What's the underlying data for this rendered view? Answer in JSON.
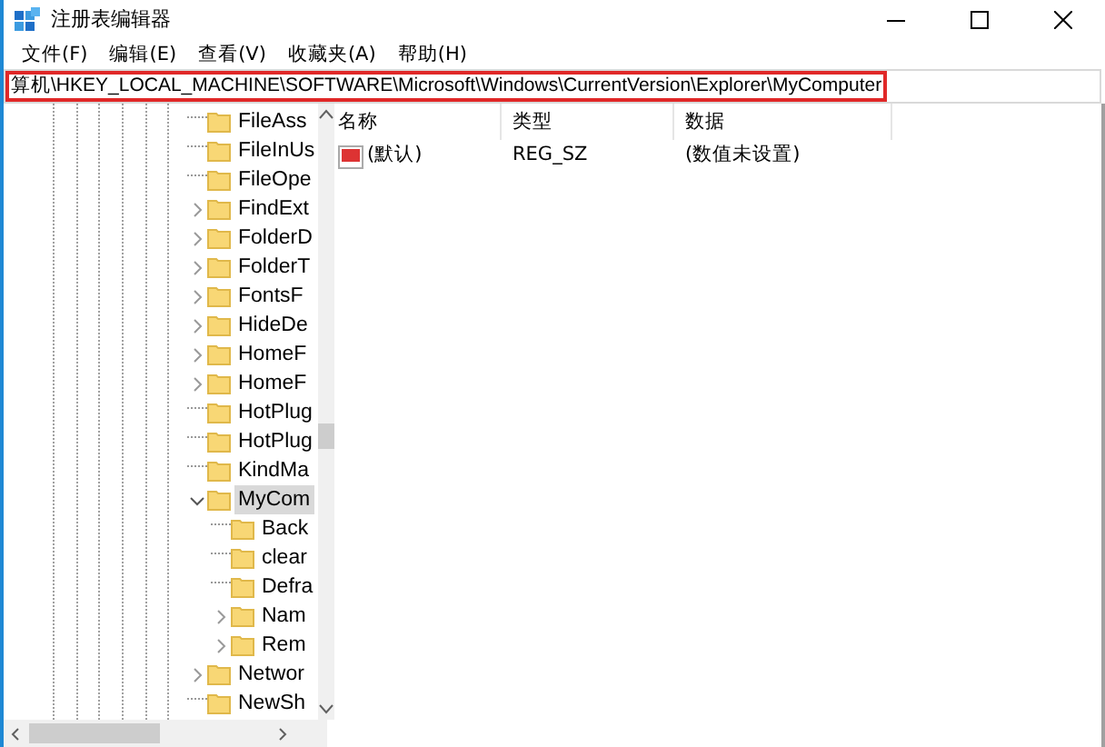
{
  "window": {
    "title": "注册表编辑器"
  },
  "menu": [
    "文件(F)",
    "编辑(E)",
    "查看(V)",
    "收藏夹(A)",
    "帮助(H)"
  ],
  "address": "算机\\HKEY_LOCAL_MACHINE\\SOFTWARE\\Microsoft\\Windows\\CurrentVersion\\Explorer\\MyComputer",
  "tree": [
    {
      "label": "FileAss",
      "selected": false
    },
    {
      "label": "FileInUs",
      "selected": false
    },
    {
      "label": "FileOpe",
      "selected": false
    },
    {
      "label": "FindExt",
      "expanded": false,
      "selected": false
    },
    {
      "label": "FolderD",
      "expanded": false,
      "selected": false
    },
    {
      "label": "FolderT",
      "expanded": false,
      "selected": false
    },
    {
      "label": "FontsF",
      "expanded": false,
      "selected": false
    },
    {
      "label": "HideDe",
      "expanded": false,
      "selected": false
    },
    {
      "label": "HomeF",
      "expanded": false,
      "selected": false
    },
    {
      "label": "HomeF",
      "expanded": false,
      "selected": false
    },
    {
      "label": "HotPlug",
      "selected": false
    },
    {
      "label": "HotPlug",
      "selected": false
    },
    {
      "label": "KindMa",
      "selected": false
    },
    {
      "label": "MyCom",
      "expanded": true,
      "selected": true,
      "children": [
        {
          "label": "Back",
          "selected": false
        },
        {
          "label": "clear",
          "selected": false
        },
        {
          "label": "Defra",
          "selected": false
        },
        {
          "label": "Nam",
          "expanded": false,
          "selected": false
        },
        {
          "label": "Rem",
          "expanded": false,
          "selected": false
        }
      ]
    },
    {
      "label": "Networ",
      "expanded": false,
      "selected": false
    },
    {
      "label": "NewSh",
      "selected": false
    }
  ],
  "table": {
    "columns": [
      "名称",
      "类型",
      "数据"
    ],
    "rows": [
      {
        "name": "(默认)",
        "type": "REG_SZ",
        "data": "(数值未设置)"
      }
    ]
  }
}
